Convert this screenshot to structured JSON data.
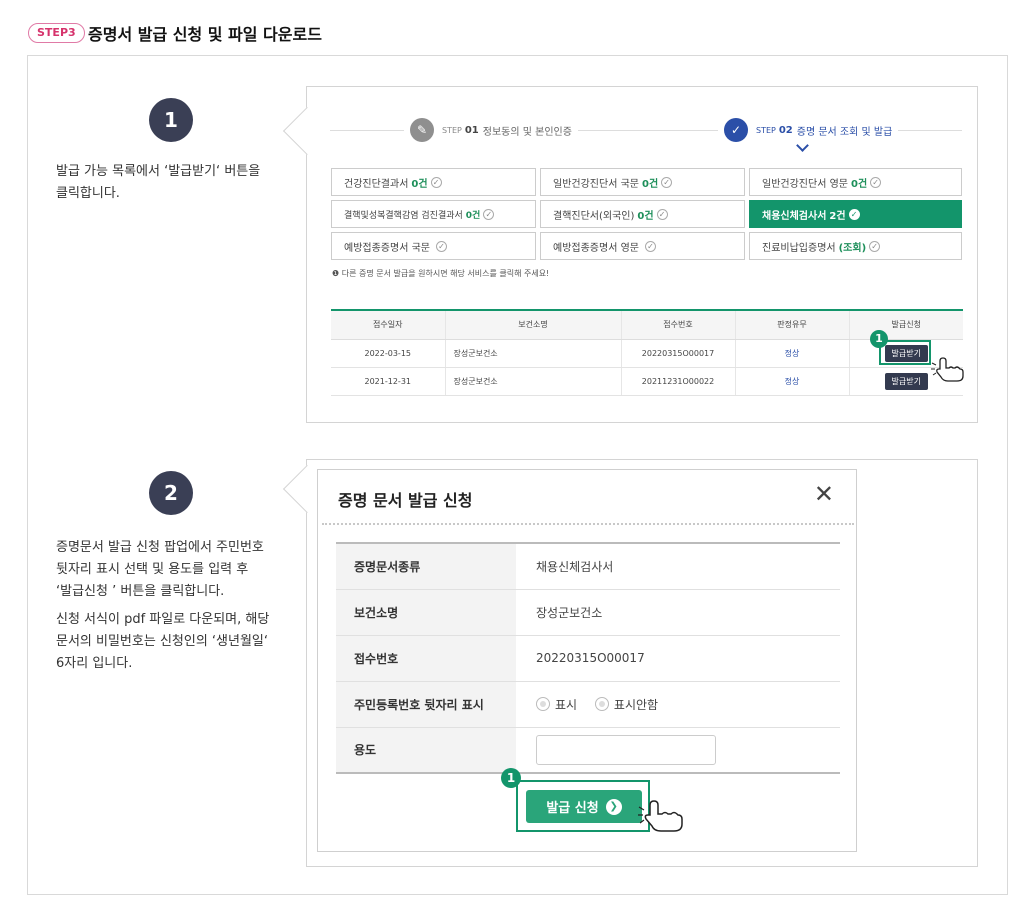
{
  "header": {
    "badge": "STEP3",
    "title": "증명서 발급 신청 및 파일 다운로드"
  },
  "section1": {
    "number": "1",
    "description_line1": "발급 가능 목록에서 ‘발급받기‘ 버튼을",
    "description_line2": "클릭합니다.",
    "steps": [
      {
        "label": "STEP",
        "num": "01",
        "title": "정보동의 및 본인인증"
      },
      {
        "label": "STEP",
        "num": "02",
        "title": "증명 문서 조회 및 발급"
      }
    ],
    "certs": [
      {
        "name": "건강진단결과서",
        "count": "0건",
        "active": false
      },
      {
        "name": "일반건강진단서 국문",
        "count": "0건",
        "active": false
      },
      {
        "name": "일반건강진단서 영문",
        "count": "0건",
        "active": false
      },
      {
        "name": "결핵및성복결핵감염 검진결과서",
        "count": "0건",
        "active": false
      },
      {
        "name": "결핵진단서(외국인)",
        "count": "0건",
        "active": false
      },
      {
        "name": "채용신체검사서",
        "count": "2건",
        "active": true
      },
      {
        "name": "예방접종증명서 국문",
        "count": "",
        "active": false
      },
      {
        "name": "예방접종증명서 영문",
        "count": "",
        "active": false
      },
      {
        "name": "진료비납입증명서",
        "count": "(조회)",
        "active": false
      }
    ],
    "notice": "❶ 다른 증명 문서 발급을 원하시면 해당 서비스를 클릭해 주세요!",
    "table": {
      "headers": [
        "접수일자",
        "보건소명",
        "접수번호",
        "판정유무",
        "발급신청"
      ],
      "rows": [
        {
          "date": "2022-03-15",
          "office": "장성군보건소",
          "receipt": "20220315O00017",
          "result": "정상",
          "action": "발급받기"
        },
        {
          "date": "2021-12-31",
          "office": "장성군보건소",
          "receipt": "20211231O00022",
          "result": "정상",
          "action": "발급받기"
        }
      ]
    },
    "marker": "1"
  },
  "section2": {
    "number": "2",
    "description": [
      "증명문서 발급 신청 팝업에서 주민번호",
      "뒷자리 표시 선택 및 용도를 입력 후",
      "‘발급신청 ’ 버튼을 클릭합니다.",
      "신청 서식이 pdf 파일로 다운되며, 해당",
      "문서의 비밀번호는 신청인의 ‘생년월일‘",
      "6자리 입니다."
    ],
    "popup": {
      "title": "증명 문서 발급 신청",
      "close": "✕",
      "fields": [
        {
          "label": "증명문서종류",
          "value": "채용신체검사서"
        },
        {
          "label": "보건소명",
          "value": "장성군보건소"
        },
        {
          "label": "접수번호",
          "value": "20220315O00017"
        },
        {
          "label": "주민등록번호 뒷자리 표시",
          "value": ""
        },
        {
          "label": "용도",
          "value": ""
        }
      ],
      "radio_options": [
        "표시",
        "표시안함"
      ],
      "submit": "발급 신청"
    },
    "marker": "1"
  }
}
